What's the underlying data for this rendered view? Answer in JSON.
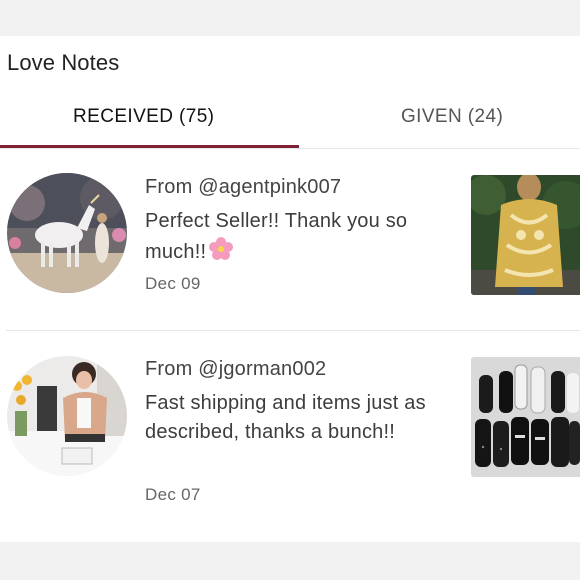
{
  "header": {
    "title": "Love Notes"
  },
  "tabs": [
    {
      "label": "RECEIVED (75)",
      "active": true
    },
    {
      "label": "GIVEN (24)",
      "active": false
    }
  ],
  "notes": [
    {
      "from": "From @agentpink007",
      "message": "Perfect Seller!! Thank you so much!!",
      "emoji": "cherry-blossom-icon",
      "date": "Dec 09"
    },
    {
      "from": "From @jgorman002",
      "message": "Fast shipping and items just as described, thanks a bunch!!",
      "date": "Dec 07"
    }
  ],
  "colors": {
    "accent": "#7f2035",
    "background": "#f2f2f2",
    "card": "#ffffff"
  }
}
